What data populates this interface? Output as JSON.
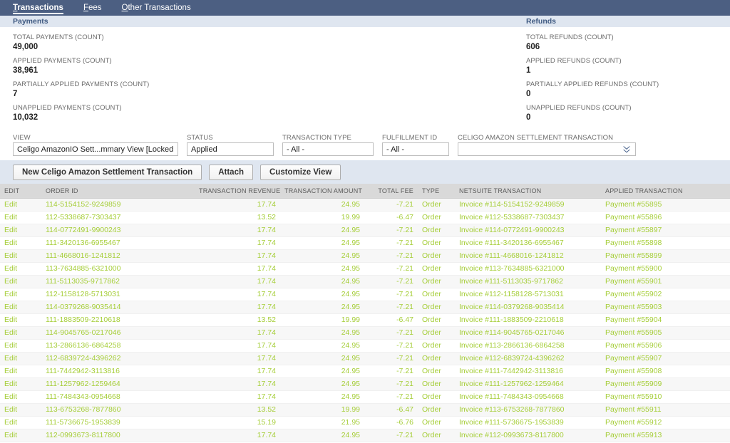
{
  "tabs": [
    {
      "label": "Transactions",
      "accesskey": "T",
      "active": true
    },
    {
      "label": "Fees",
      "accesskey": "F",
      "active": false
    },
    {
      "label": "Other Transactions",
      "accesskey": "O",
      "active": false
    }
  ],
  "summary": {
    "payments_header": "Payments",
    "refunds_header": "Refunds",
    "payments": [
      {
        "label": "TOTAL PAYMENTS (COUNT)",
        "value": "49,000"
      },
      {
        "label": "APPLIED PAYMENTS (COUNT)",
        "value": "38,961"
      },
      {
        "label": "PARTIALLY APPLIED PAYMENTS (COUNT)",
        "value": "7"
      },
      {
        "label": "UNAPPLIED PAYMENTS (COUNT)",
        "value": "10,032"
      }
    ],
    "refunds": [
      {
        "label": "TOTAL REFUNDS (COUNT)",
        "value": "606"
      },
      {
        "label": "APPLIED REFUNDS (COUNT)",
        "value": "1"
      },
      {
        "label": "PARTIALLY APPLIED REFUNDS (COUNT)",
        "value": "0"
      },
      {
        "label": "UNAPPLIED REFUNDS (COUNT)",
        "value": "0"
      }
    ]
  },
  "filters": {
    "view": {
      "label": "VIEW",
      "value": "Celigo AmazonIO Sett...mmary View  [Locked"
    },
    "status": {
      "label": "STATUS",
      "value": "Applied"
    },
    "transaction_type": {
      "label": "TRANSACTION TYPE",
      "value": "- All -"
    },
    "fulfillment_id": {
      "label": "FULFILLMENT ID",
      "value": "- All -"
    },
    "celigo_settlement": {
      "label": "CELIGO AMAZON SETTLEMENT TRANSACTION",
      "value": "",
      "placeholder": ""
    }
  },
  "toolbar": {
    "new_label": "New Celigo Amazon Settlement Transaction",
    "attach_label": "Attach",
    "customize_label": "Customize View"
  },
  "table": {
    "columns": [
      "EDIT",
      "ORDER ID",
      "TRANSACTION REVENUE",
      "TRANSACTION AMOUNT",
      "TOTAL FEE",
      "TYPE",
      "NETSUITE TRANSACTION",
      "APPLIED TRANSACTION"
    ],
    "edit_label": "Edit",
    "rows": [
      {
        "order_id": "114-5154152-9249859",
        "revenue": "17.74",
        "amount": "24.95",
        "fee": "-7.21",
        "type": "Order",
        "netsuite": "Invoice #114-5154152-9249859",
        "applied": "Payment #55895"
      },
      {
        "order_id": "112-5338687-7303437",
        "revenue": "13.52",
        "amount": "19.99",
        "fee": "-6.47",
        "type": "Order",
        "netsuite": "Invoice #112-5338687-7303437",
        "applied": "Payment #55896"
      },
      {
        "order_id": "114-0772491-9900243",
        "revenue": "17.74",
        "amount": "24.95",
        "fee": "-7.21",
        "type": "Order",
        "netsuite": "Invoice #114-0772491-9900243",
        "applied": "Payment #55897"
      },
      {
        "order_id": "111-3420136-6955467",
        "revenue": "17.74",
        "amount": "24.95",
        "fee": "-7.21",
        "type": "Order",
        "netsuite": "Invoice #111-3420136-6955467",
        "applied": "Payment #55898"
      },
      {
        "order_id": "111-4668016-1241812",
        "revenue": "17.74",
        "amount": "24.95",
        "fee": "-7.21",
        "type": "Order",
        "netsuite": "Invoice #111-4668016-1241812",
        "applied": "Payment #55899"
      },
      {
        "order_id": "113-7634885-6321000",
        "revenue": "17.74",
        "amount": "24.95",
        "fee": "-7.21",
        "type": "Order",
        "netsuite": "Invoice #113-7634885-6321000",
        "applied": "Payment #55900"
      },
      {
        "order_id": "111-5113035-9717862",
        "revenue": "17.74",
        "amount": "24.95",
        "fee": "-7.21",
        "type": "Order",
        "netsuite": "Invoice #111-5113035-9717862",
        "applied": "Payment #55901"
      },
      {
        "order_id": "112-1158128-5713031",
        "revenue": "17.74",
        "amount": "24.95",
        "fee": "-7.21",
        "type": "Order",
        "netsuite": "Invoice #112-1158128-5713031",
        "applied": "Payment #55902"
      },
      {
        "order_id": "114-0379268-9035414",
        "revenue": "17.74",
        "amount": "24.95",
        "fee": "-7.21",
        "type": "Order",
        "netsuite": "Invoice #114-0379268-9035414",
        "applied": "Payment #55903"
      },
      {
        "order_id": "111-1883509-2210618",
        "revenue": "13.52",
        "amount": "19.99",
        "fee": "-6.47",
        "type": "Order",
        "netsuite": "Invoice #111-1883509-2210618",
        "applied": "Payment #55904"
      },
      {
        "order_id": "114-9045765-0217046",
        "revenue": "17.74",
        "amount": "24.95",
        "fee": "-7.21",
        "type": "Order",
        "netsuite": "Invoice #114-9045765-0217046",
        "applied": "Payment #55905"
      },
      {
        "order_id": "113-2866136-6864258",
        "revenue": "17.74",
        "amount": "24.95",
        "fee": "-7.21",
        "type": "Order",
        "netsuite": "Invoice #113-2866136-6864258",
        "applied": "Payment #55906"
      },
      {
        "order_id": "112-6839724-4396262",
        "revenue": "17.74",
        "amount": "24.95",
        "fee": "-7.21",
        "type": "Order",
        "netsuite": "Invoice #112-6839724-4396262",
        "applied": "Payment #55907"
      },
      {
        "order_id": "111-7442942-3113816",
        "revenue": "17.74",
        "amount": "24.95",
        "fee": "-7.21",
        "type": "Order",
        "netsuite": "Invoice #111-7442942-3113816",
        "applied": "Payment #55908"
      },
      {
        "order_id": "111-1257962-1259464",
        "revenue": "17.74",
        "amount": "24.95",
        "fee": "-7.21",
        "type": "Order",
        "netsuite": "Invoice #111-1257962-1259464",
        "applied": "Payment #55909"
      },
      {
        "order_id": "111-7484343-0954668",
        "revenue": "17.74",
        "amount": "24.95",
        "fee": "-7.21",
        "type": "Order",
        "netsuite": "Invoice #111-7484343-0954668",
        "applied": "Payment #55910"
      },
      {
        "order_id": "113-6753268-7877860",
        "revenue": "13.52",
        "amount": "19.99",
        "fee": "-6.47",
        "type": "Order",
        "netsuite": "Invoice #113-6753268-7877860",
        "applied": "Payment #55911"
      },
      {
        "order_id": "111-5736675-1953839",
        "revenue": "15.19",
        "amount": "21.95",
        "fee": "-6.76",
        "type": "Order",
        "netsuite": "Invoice #111-5736675-1953839",
        "applied": "Payment #55912"
      },
      {
        "order_id": "112-0993673-8117800",
        "revenue": "17.74",
        "amount": "24.95",
        "fee": "-7.21",
        "type": "Order",
        "netsuite": "Invoice #112-0993673-8117800",
        "applied": "Payment #55913"
      }
    ]
  },
  "colors": {
    "tabbar": "#4c5f82",
    "section_header": "#dfe6f0",
    "link_green": "#a6ce39",
    "table_header": "#d9d9d9"
  }
}
